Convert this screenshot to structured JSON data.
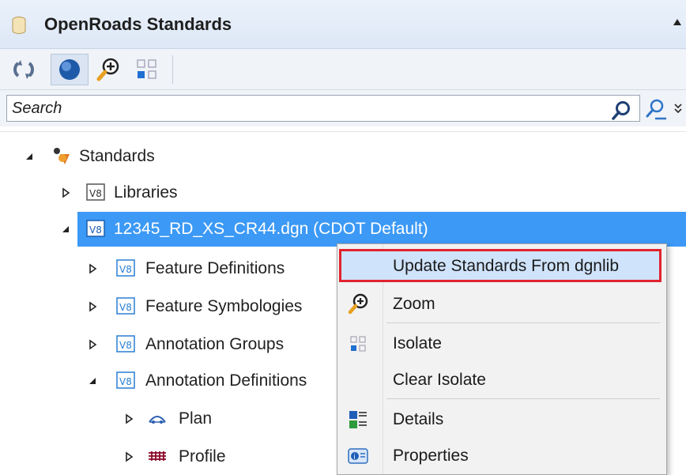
{
  "panel": {
    "title": "OpenRoads Standards"
  },
  "toolbar": {
    "buttons": [
      "refresh-icon",
      "globe-icon",
      "zoom-icon",
      "isolate-icon"
    ]
  },
  "search": {
    "placeholder": "Search"
  },
  "tree": {
    "root": "Standards",
    "libraries": "Libraries",
    "dgn": "12345_RD_XS_CR44.dgn (CDOT Default)",
    "feature_definitions": "Feature Definitions",
    "feature_symbologies": "Feature Symbologies",
    "annotation_groups": "Annotation Groups",
    "annotation_definitions": "Annotation Definitions",
    "plan": "Plan",
    "profile": "Profile"
  },
  "context_menu": {
    "update": "Update Standards From dgnlib",
    "zoom": "Zoom",
    "isolate": "Isolate",
    "clear_isolate": "Clear Isolate",
    "details": "Details",
    "properties": "Properties"
  },
  "colors": {
    "selection": "#3c99f5",
    "highlight_border": "#e0232e",
    "v8_icon": "#2a7fd4"
  }
}
